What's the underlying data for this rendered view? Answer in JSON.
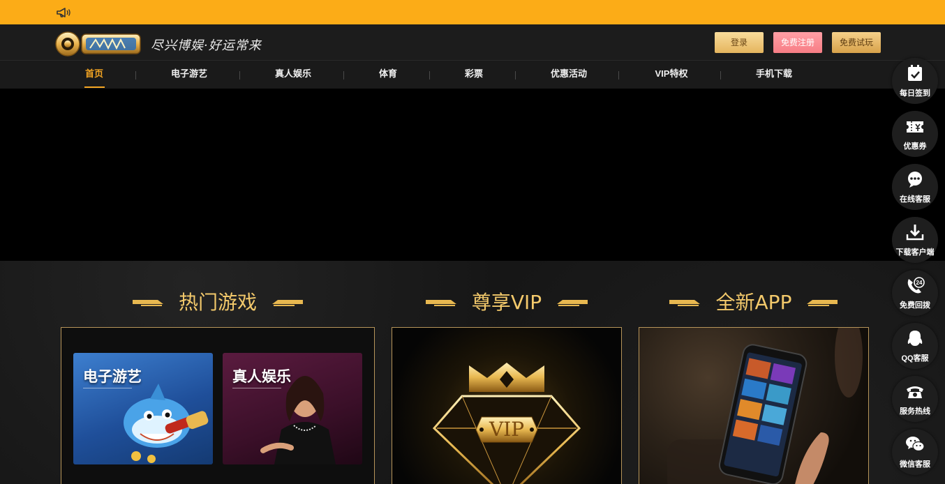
{
  "notice_bar": {
    "icon": "megaphone-icon"
  },
  "header": {
    "slogan": "尽兴博娱·好运常来",
    "buttons": {
      "login": "登录",
      "register": "免费注册",
      "trial": "免费试玩"
    }
  },
  "nav": {
    "items": [
      {
        "label": "首页"
      },
      {
        "label": "电子游艺"
      },
      {
        "label": "真人娱乐"
      },
      {
        "label": "体育"
      },
      {
        "label": "彩票"
      },
      {
        "label": "优惠活动"
      },
      {
        "label": "VIP特权"
      },
      {
        "label": "手机下载"
      }
    ]
  },
  "sections": {
    "games": {
      "title": "热门游戏",
      "cards": [
        {
          "label": "电子游艺"
        },
        {
          "label": "真人娱乐"
        }
      ]
    },
    "vip": {
      "title": "尊享VIP",
      "badge": "VIP"
    },
    "app": {
      "title": "全新APP"
    }
  },
  "sidebar": {
    "items": [
      {
        "label": "每日签到",
        "icon": "calendar-check-icon"
      },
      {
        "label": "优惠券",
        "icon": "coupon-icon"
      },
      {
        "label": "在线客服",
        "icon": "chat-icon"
      },
      {
        "label": "下载客户端",
        "icon": "download-icon"
      },
      {
        "label": "免费回拨",
        "icon": "phone-24-icon"
      },
      {
        "label": "QQ客服",
        "icon": "qq-icon"
      },
      {
        "label": "服务热线",
        "icon": "telephone-icon"
      },
      {
        "label": "微信客服",
        "icon": "wechat-icon"
      }
    ]
  },
  "colors": {
    "accent": "#fcac17",
    "gold": "#f3c96b",
    "nav_active": "#f5a623"
  }
}
